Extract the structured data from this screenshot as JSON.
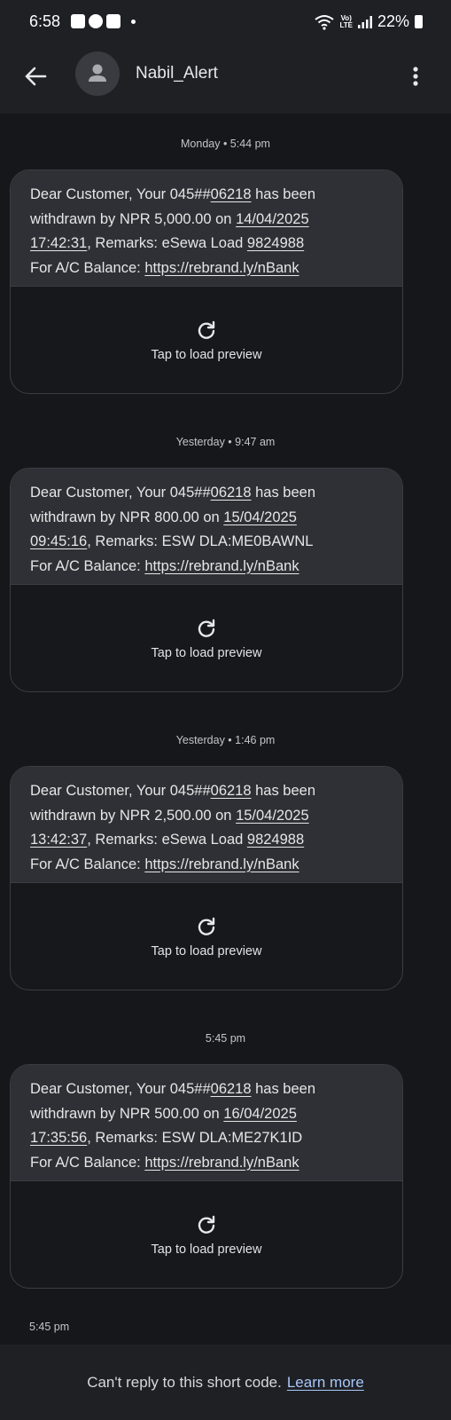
{
  "status_bar": {
    "time": "6:58",
    "volte_top": "Vo)",
    "volte_bottom": "LTE",
    "battery": "22%"
  },
  "header": {
    "contact_name": "Nabil_Alert"
  },
  "messages": [
    {
      "timestamp": "Monday • 5:44 pm",
      "pre_acct": "Dear Customer, Your 045##",
      "acct_tail": "06218",
      "post_acct": " has been",
      "withdrawn": "withdrawn by NPR 5,000.00 on ",
      "date": "14/04/2025",
      "time": "17:42:31",
      "remarks_prefix": ", Remarks: eSewa Load ",
      "remarks_number": "9824988",
      "balance_prefix": "For A/C Balance: ",
      "link": "https://rebrand.ly/nBank",
      "preview": "Tap to load preview"
    },
    {
      "timestamp": "Yesterday • 9:47 am",
      "pre_acct": "Dear Customer, Your 045##",
      "acct_tail": "06218",
      "post_acct": " has been",
      "withdrawn": "withdrawn by NPR 800.00 on ",
      "date": "15/04/2025",
      "time": "09:45:16",
      "remarks_prefix": ", Remarks: ESW DLA:ME0BAWNL",
      "remarks_number": "",
      "balance_prefix": "For A/C Balance: ",
      "link": "https://rebrand.ly/nBank",
      "preview": "Tap to load preview"
    },
    {
      "timestamp": "Yesterday • 1:46 pm",
      "pre_acct": "Dear Customer, Your 045##",
      "acct_tail": "06218",
      "post_acct": " has been",
      "withdrawn": "withdrawn by NPR 2,500.00 on ",
      "date": "15/04/2025",
      "time": "13:42:37",
      "remarks_prefix": ", Remarks: eSewa Load ",
      "remarks_number": "9824988",
      "balance_prefix": "For A/C Balance: ",
      "link": "https://rebrand.ly/nBank",
      "preview": "Tap to load preview"
    },
    {
      "timestamp": "5:45 pm",
      "pre_acct": "Dear Customer, Your 045##",
      "acct_tail": "06218",
      "post_acct": " has been",
      "withdrawn": "withdrawn by NPR 500.00 on ",
      "date": "16/04/2025",
      "time": "17:35:56",
      "remarks_prefix": ", Remarks: ESW DLA:ME27K1ID",
      "remarks_number": "",
      "balance_prefix": "For A/C Balance: ",
      "link": "https://rebrand.ly/nBank",
      "preview": "Tap to load preview"
    }
  ],
  "last_sent_time": "5:45 pm",
  "footer": {
    "notice": "Can't reply to this short code.",
    "link": "Learn more"
  },
  "colors": {
    "background": "#16171b",
    "bar": "#1f2024",
    "bubble": "#2f3035",
    "link": "#a8c7fa"
  }
}
